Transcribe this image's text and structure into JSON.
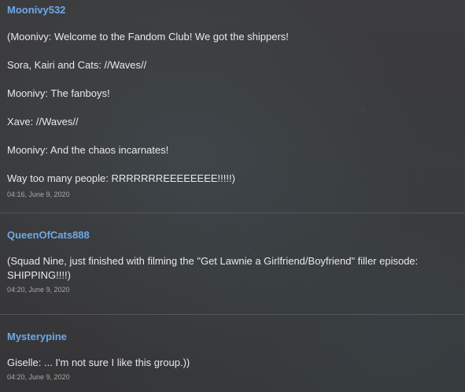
{
  "posts": [
    {
      "author": "Moonivy532",
      "lines": [
        "(Moonivy: Welcome to the Fandom Club! We got the shippers!",
        "Sora, Kairi and Cats: //Waves//",
        "Moonivy: The fanboys!",
        "Xave: //Waves//",
        "Moonivy: And the chaos incarnates!",
        "Way too many people: RRRRRRREEEEEEEE!!!!!)"
      ],
      "timestamp": "04:16, June 9, 2020"
    },
    {
      "author": "QueenOfCats888",
      "lines": [
        "(Squad Nine, just finished with filming the \"Get Lawnie a Girlfriend/Boyfriend\" filler episode: SHIPPING!!!!)"
      ],
      "timestamp": "04:20, June 9, 2020"
    },
    {
      "author": "Mysterypine",
      "lines": [
        "Giselle: ... I'm not sure I like this group.))"
      ],
      "timestamp": "04:20, June 9, 2020"
    }
  ],
  "colors": {
    "author_link": "#6ea8e8",
    "background": "#3a3a3c",
    "divider": "#555557"
  }
}
